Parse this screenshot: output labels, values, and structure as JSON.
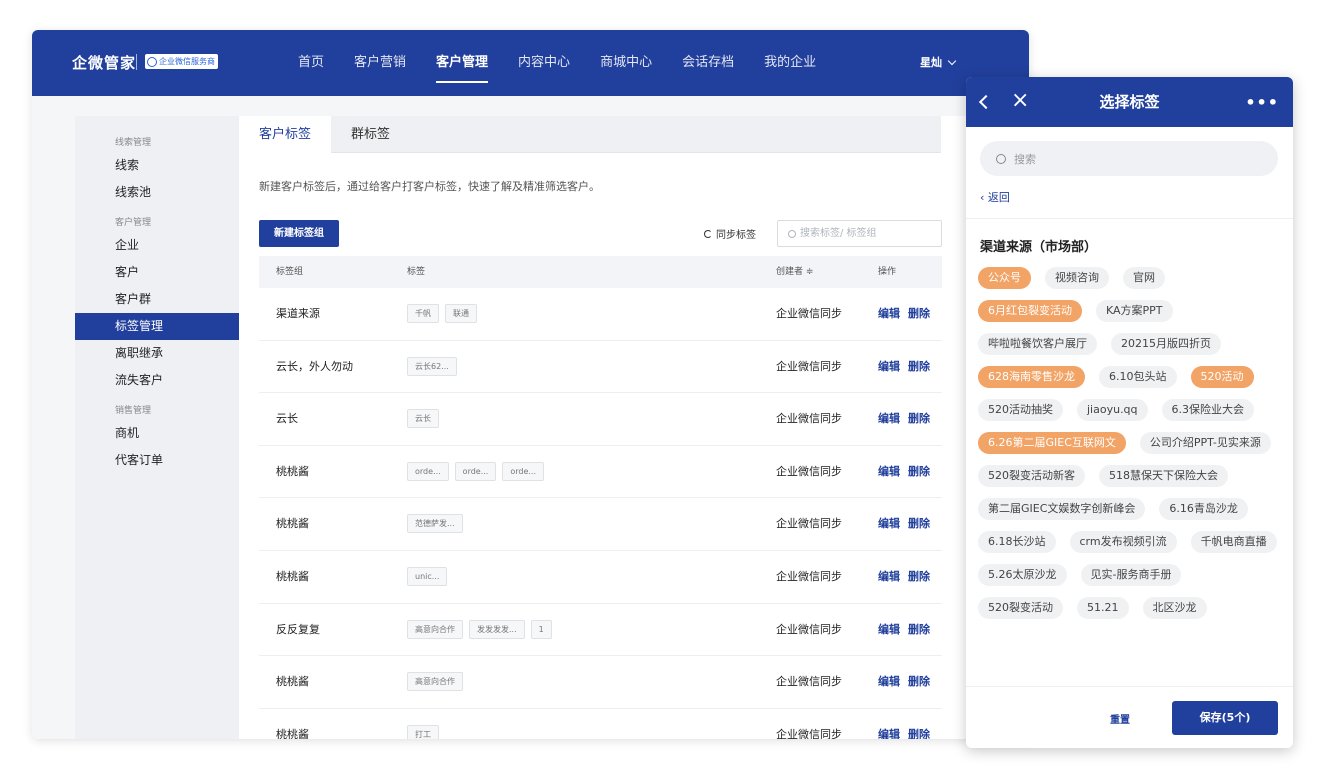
{
  "header": {
    "brand": "企微管家",
    "badge": "企业微信服务商",
    "nav": [
      "首页",
      "客户营销",
      "客户管理",
      "内容中心",
      "商城中心",
      "会话存档",
      "我的企业"
    ],
    "active_nav": "客户管理",
    "user": "星灿"
  },
  "sidebar": {
    "groups": [
      {
        "title": "线索管理",
        "items": [
          "线索",
          "线索池"
        ]
      },
      {
        "title": "客户管理",
        "items": [
          "企业",
          "客户",
          "客户群",
          "标签管理",
          "离职继承",
          "流失客户"
        ]
      },
      {
        "title": "销售管理",
        "items": [
          "商机",
          "代客订单"
        ]
      }
    ],
    "active_item": "标签管理"
  },
  "main": {
    "tabs": [
      "客户标签",
      "群标签"
    ],
    "active_tab": "客户标签",
    "description": "新建客户标签后，通过给客户打客户标签，快速了解及精准筛选客户。",
    "new_button": "新建标签组",
    "sync_label": "同步标签",
    "search_placeholder": "搜索标签/ 标签组",
    "table": {
      "headers": {
        "group": "标签组",
        "tags": "标签",
        "creator": "创建者 ≑",
        "ops": "操作"
      },
      "rows": [
        {
          "group": "渠道来源",
          "tags": [
            "千帆",
            "联通"
          ],
          "creator": "企业微信同步"
        },
        {
          "group": "云长，外人勿动",
          "tags": [
            "云长62..."
          ],
          "creator": "企业微信同步"
        },
        {
          "group": "云长",
          "tags": [
            "云长"
          ],
          "creator": "企业微信同步"
        },
        {
          "group": "桃桃酱",
          "tags": [
            "orde...",
            "orde...",
            "orde..."
          ],
          "creator": "企业微信同步"
        },
        {
          "group": "桃桃酱",
          "tags": [
            "范德萨发..."
          ],
          "creator": "企业微信同步"
        },
        {
          "group": "桃桃酱",
          "tags": [
            "unic..."
          ],
          "creator": "企业微信同步"
        },
        {
          "group": "反反复复",
          "tags": [
            "高意向合作",
            "发发发发...",
            "1"
          ],
          "creator": "企业微信同步"
        },
        {
          "group": "桃桃酱",
          "tags": [
            "高意向合作"
          ],
          "creator": "企业微信同步"
        },
        {
          "group": "桃桃酱",
          "tags": [
            "打工"
          ],
          "creator": "企业微信同步"
        }
      ],
      "edit_label": "编辑",
      "delete_label": "删除"
    }
  },
  "panel": {
    "title": "选择标签",
    "more": "•••",
    "search_placeholder": "搜索",
    "back_label": "返回",
    "section_title": "渠道来源（市场部）",
    "tags": [
      {
        "label": "公众号",
        "selected": true
      },
      {
        "label": "视频咨询",
        "selected": false
      },
      {
        "label": "官网",
        "selected": false
      },
      {
        "label": "6月红包裂变活动",
        "selected": true
      },
      {
        "label": "KA方案PPT",
        "selected": false
      },
      {
        "label": "哔啦啦餐饮客户展厅",
        "selected": false
      },
      {
        "label": "20215月版四折页",
        "selected": false
      },
      {
        "label": "628海南零售沙龙",
        "selected": true
      },
      {
        "label": "6.10包头站",
        "selected": false
      },
      {
        "label": "520活动",
        "selected": true
      },
      {
        "label": "520活动抽奖",
        "selected": false
      },
      {
        "label": "jiaoyu.qq",
        "selected": false
      },
      {
        "label": "6.3保险业大会",
        "selected": false
      },
      {
        "label": "6.26第二届GIEC互联网文",
        "selected": true
      },
      {
        "label": "公司介绍PPT-见实来源",
        "selected": false
      },
      {
        "label": "520裂变活动新客",
        "selected": false
      },
      {
        "label": "518慧保天下保险大会",
        "selected": false
      },
      {
        "label": "第二届GIEC文娱数字创新峰会",
        "selected": false
      },
      {
        "label": "6.16青岛沙龙",
        "selected": false
      },
      {
        "label": "6.18长沙站",
        "selected": false
      },
      {
        "label": "crm发布视频引流",
        "selected": false
      },
      {
        "label": "千帆电商直播",
        "selected": false
      },
      {
        "label": "5.26太原沙龙",
        "selected": false
      },
      {
        "label": "见实-服务商手册",
        "selected": false
      },
      {
        "label": "520裂变活动",
        "selected": false
      },
      {
        "label": "51.21",
        "selected": false
      },
      {
        "label": "北区沙龙",
        "selected": false
      }
    ],
    "reset_label": "重置",
    "save_label": "保存(5个)"
  },
  "colors": {
    "primary": "#213f9c",
    "selected_tag": "#f2a366"
  }
}
